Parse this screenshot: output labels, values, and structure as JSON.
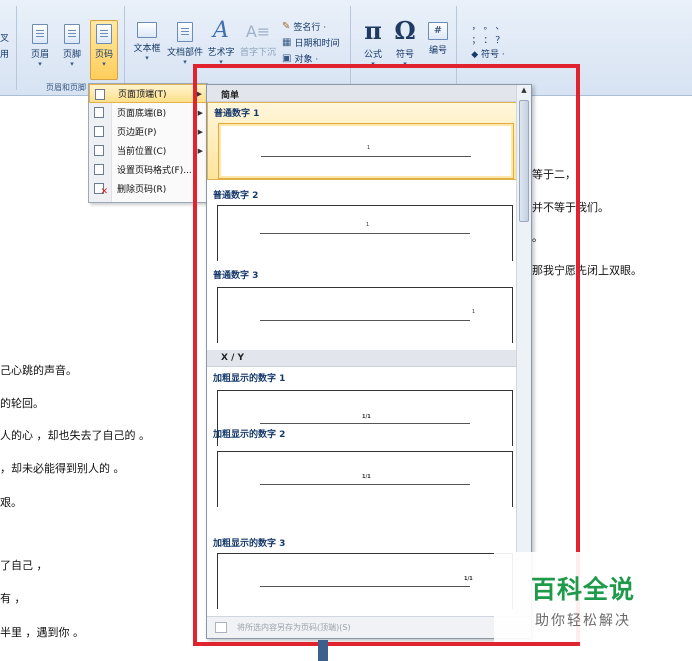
{
  "ribbon": {
    "left_partial": [
      "叉",
      "用"
    ],
    "header": "页眉",
    "footer": "页脚",
    "page_number": "页码",
    "text_box": "文本框",
    "doc_parts": "文档部件",
    "wordart": "艺术字",
    "dropcap": "首字下沉",
    "signature_line": "签名行 ·",
    "datetime": "日期和时间",
    "object": "对象 ·",
    "equation": "公式",
    "symbol": "符号",
    "numbering": "编号",
    "special_symbol": "◆ 符号 ·",
    "group_header_footer": "页眉和页脚",
    "icons": {
      "equation": "π",
      "symbol": "Ω",
      "numbering": "#",
      "special_symbols": "， 。 、 ； ： ？"
    }
  },
  "submenu": {
    "items": [
      {
        "label": "页面顶端(T)",
        "has_arrow": true,
        "highlighted": true
      },
      {
        "label": "页面底端(B)",
        "has_arrow": true
      },
      {
        "label": "页边距(P)",
        "has_arrow": true
      },
      {
        "label": "当前位置(C)",
        "has_arrow": true
      },
      {
        "label": "设置页码格式(F)..."
      },
      {
        "label": "删除页码(R)",
        "icon": "delete-page-number-icon"
      }
    ]
  },
  "gallery": {
    "section_simple": "简单",
    "section_xy": "X / Y",
    "items": [
      {
        "label": "普通数字 1",
        "num": "1"
      },
      {
        "label": "普通数字 2",
        "num": "1"
      },
      {
        "label": "普通数字 3",
        "num": "1"
      },
      {
        "label": "加粗显示的数字 1",
        "num": "1/1"
      },
      {
        "label": "加粗显示的数字 2",
        "num": "1/1"
      },
      {
        "label": "加粗显示的数字 3",
        "num": "1/1"
      }
    ],
    "footer": "将所选内容另存为页码(顶端)(S)"
  },
  "document": {
    "right_lines": [
      "等于二，",
      "并不等于我们。",
      "。",
      "那我宁愿先闭上双眼。"
    ],
    "left_lines": [
      "己心跳的声音。",
      "的轮回。",
      "人的心 ，却也失去了自己的 。",
      "，却未必能得到别人的 。",
      "艰。",
      "了自己 ，",
      "有 ，",
      "半里 ，遇到你 。"
    ]
  },
  "watermark": {
    "title": "百科全说",
    "subtitle": "助你轻松解决"
  },
  "colors": {
    "highlight_red": "#e0232f",
    "menu_highlight": "#ffe08a",
    "watermark_green": "#1f9a4a"
  }
}
